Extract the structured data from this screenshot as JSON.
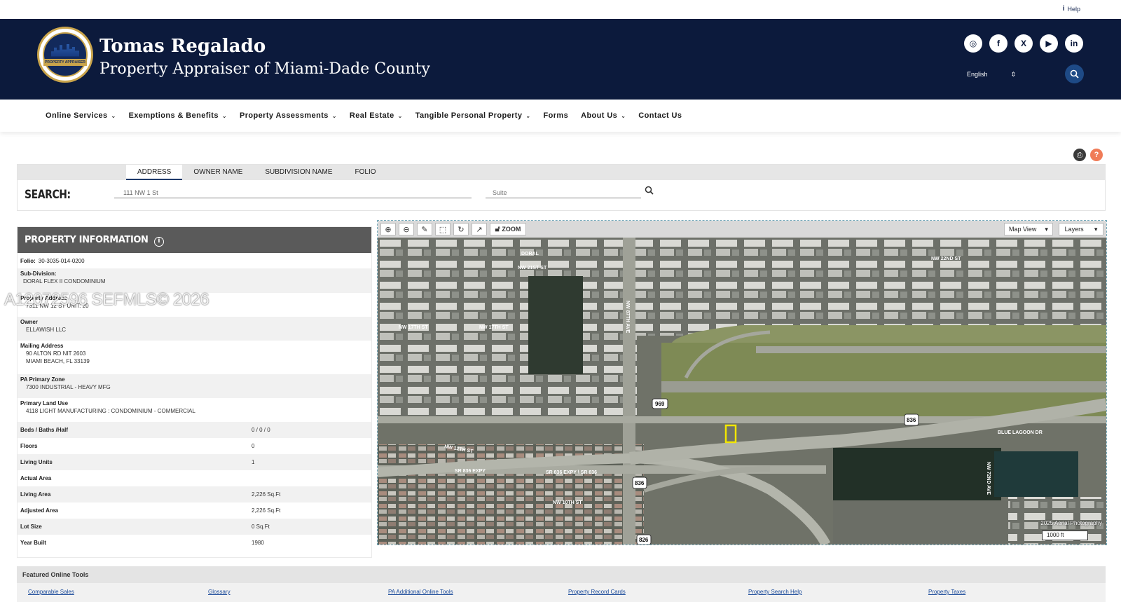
{
  "help": {
    "label": "Help"
  },
  "header": {
    "title": "Tomas Regalado",
    "subtitle": "Property Appraiser of Miami-Dade County",
    "seal_text": "PROPERTY APPRAISER",
    "language": "English",
    "social_icons": [
      "instagram-icon",
      "facebook-icon",
      "x-icon",
      "youtube-icon",
      "linkedin-icon"
    ]
  },
  "nav": {
    "items": [
      {
        "label": "Online Services"
      },
      {
        "label": "Exemptions & Benefits"
      },
      {
        "label": "Property Assessments"
      },
      {
        "label": "Real Estate"
      },
      {
        "label": "Tangible Personal Property"
      },
      {
        "label": "Forms"
      },
      {
        "label": "About Us"
      },
      {
        "label": "Contact Us"
      }
    ]
  },
  "search": {
    "tabs": [
      "ADDRESS",
      "OWNER NAME",
      "SUBDIVISION NAME",
      "FOLIO"
    ],
    "label": "SEARCH:",
    "address_value": "111 NW 1 St",
    "suite_placeholder": "Suite"
  },
  "property_info": {
    "heading": "PROPERTY INFORMATION",
    "folio_label": "Folio:",
    "folio": "30-3035-014-0200",
    "subdivision_label": "Sub-Division:",
    "subdivision": "DORAL FLEX II CONDOMINIUM",
    "address_label": "Property Address",
    "address": "7311 NW 12 ST   UNIT: 20",
    "owner_label": "Owner",
    "owner": "ELLAWISH LLC",
    "mailing_label": "Mailing Address",
    "mailing_1": "90 ALTON RD NIT 2603",
    "mailing_2": "MIAMI BEACH, FL 33139",
    "zone_label": "PA Primary Zone",
    "zone": "7300 INDUSTRIAL - HEAVY MFG",
    "land_use_label": "Primary Land Use",
    "land_use": "4118 LIGHT MANUFACTURING : CONDOMINIUM - COMMERCIAL",
    "beds_label": "Beds / Baths /Half",
    "beds": "0 / 0 / 0",
    "floors_label": "Floors",
    "floors": "0",
    "units_label": "Living Units",
    "units": "1",
    "actual_label": "Actual Area",
    "actual": "",
    "living_label": "Living Area",
    "living": "2,226 Sq.Ft",
    "adjusted_label": "Adjusted Area",
    "adjusted": "2,226 Sq.Ft",
    "lot_label": "Lot Size",
    "lot": "0 Sq.Ft",
    "year_label": "Year Built",
    "year": "1980"
  },
  "watermark": "A12072596  SEFMLS© 2026",
  "map": {
    "zoom_label": "ZOOM",
    "map_view_label": "Map View",
    "layers_label": "Layers",
    "credit": "2025 Aerial Photography",
    "scale": "1000 ft",
    "labels": {
      "doral": "DORAL",
      "nw21": "NW 21ST ST",
      "nw17a": "NW 17TH ST",
      "nw17b": "NW 17TH ST",
      "nw22": "NW 22ND ST",
      "nw12": "NW 12TH ST",
      "sr836a": "SR 836 EXPY",
      "sr836b": "SR 836 EXPY \\ SR 836",
      "nw10": "NW 10TH ST",
      "blue": "BLUE LAGOON DR",
      "shield969": "969",
      "shield836a": "836",
      "shield836b": "836",
      "shield826": "826",
      "nw87": "NW 87TH AVE",
      "nw72": "NW 72ND AVE"
    }
  },
  "featured": {
    "title": "Featured Online Tools",
    "links": [
      "Comparable Sales",
      "Glossary",
      "PA Additional Online Tools",
      "Property Record Cards",
      "Property Search Help",
      "Property Taxes"
    ]
  },
  "colors": {
    "header_bg": "#0c1a3c",
    "accent": "#c9a44b",
    "info_head": "#5a5a5a"
  }
}
